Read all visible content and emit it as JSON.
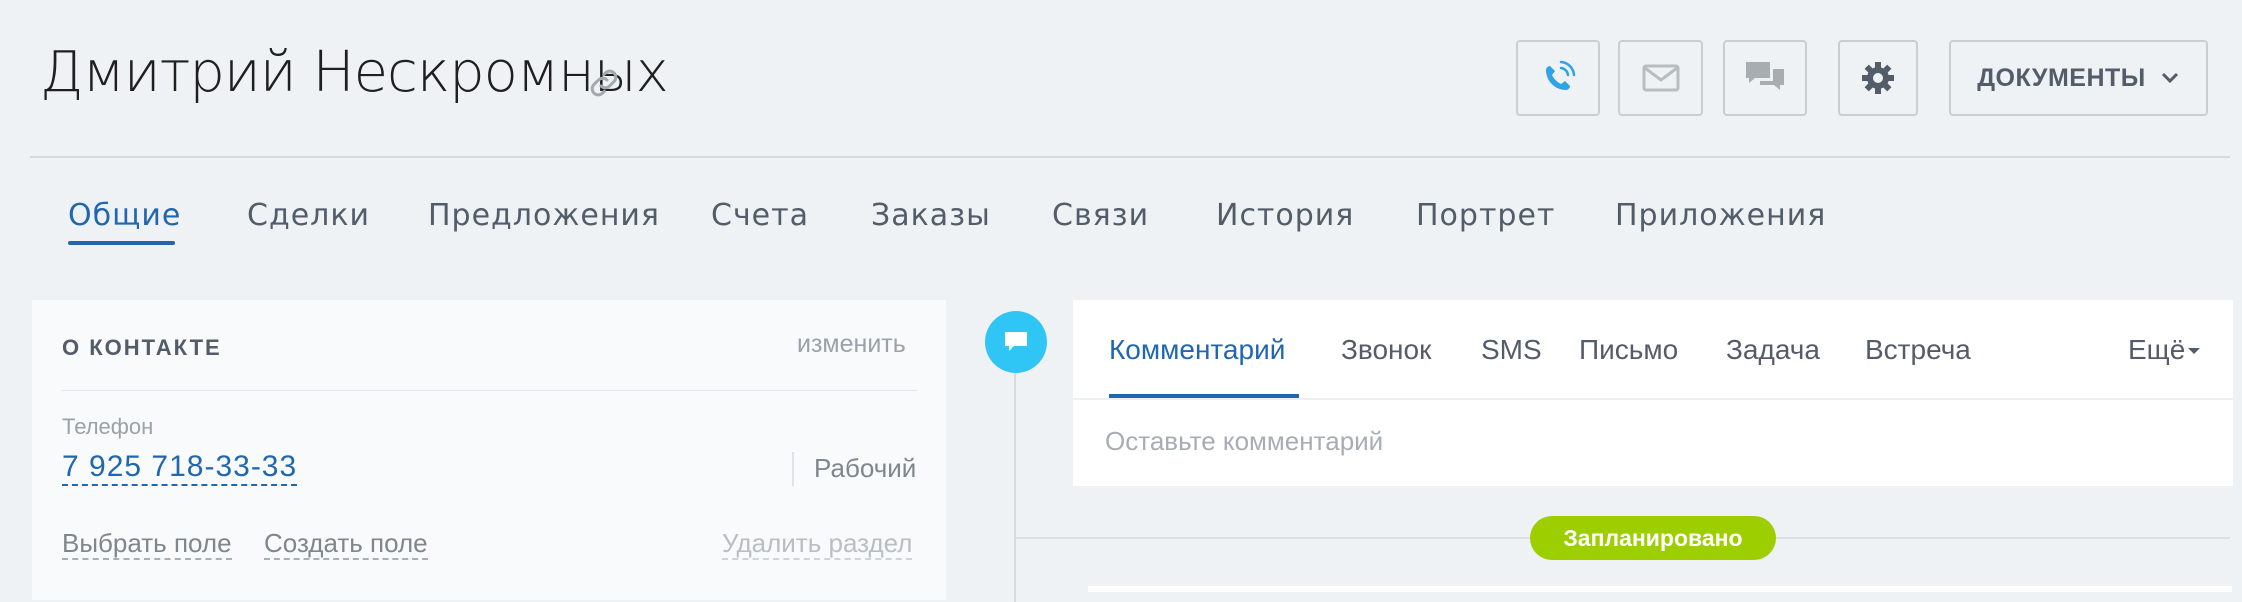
{
  "header": {
    "title": "Дмитрий Нескромных",
    "docs_label": "ДОКУМЕНТЫ"
  },
  "tabs": [
    {
      "label": "Общие",
      "active": true
    },
    {
      "label": "Сделки"
    },
    {
      "label": "Предложения"
    },
    {
      "label": "Счета"
    },
    {
      "label": "Заказы"
    },
    {
      "label": "Связи"
    },
    {
      "label": "История"
    },
    {
      "label": "Портрет"
    },
    {
      "label": "Приложения"
    }
  ],
  "contact_card": {
    "title": "О КОНТАКТЕ",
    "edit_label": "изменить",
    "phone_label": "Телефон",
    "phone_value": "7 925 718-33-33",
    "phone_type": "Рабочий",
    "select_field": "Выбрать поле",
    "create_field": "Создать поле",
    "delete_section": "Удалить раздел"
  },
  "editor": {
    "tabs": [
      "Комментарий",
      "Звонок",
      "SMS",
      "Письмо",
      "Задача",
      "Встреча"
    ],
    "more_label": "Ещё",
    "placeholder": "Оставьте комментарий"
  },
  "timeline": {
    "status_label": "Запланировано"
  },
  "colors": {
    "accent": "#2067b0",
    "timeline_icon": "#2fc6f6",
    "status_green": "#9dcf00",
    "background": "#eef2f4"
  },
  "icons": [
    "link-icon",
    "phone-call-icon",
    "envelope-icon",
    "chat-bubbles-icon",
    "gear-icon",
    "chevron-down-icon",
    "comment-icon"
  ]
}
